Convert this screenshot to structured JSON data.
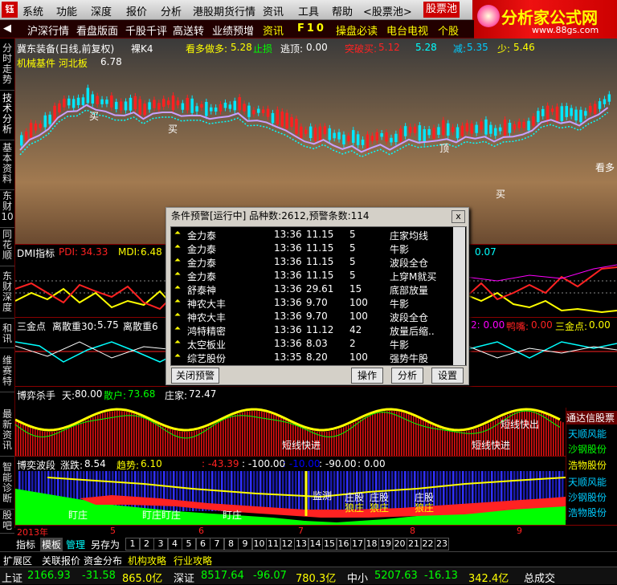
{
  "menu": {
    "logo": "钰",
    "items": [
      "系统",
      "功能",
      "深度",
      "报价",
      "分析",
      "港股期货行情",
      "资讯",
      "工具",
      "帮助",
      "<股票池>",
      "股票池"
    ],
    "brand_title": "分析家公式网",
    "brand_url": "www.88gs.com"
  },
  "toolbar": {
    "items": [
      "沪深行情",
      "看盘版面",
      "千股千评",
      "高送转",
      "业绩预增",
      "资讯",
      "F10",
      "操盘必读",
      "电台电视",
      "个股"
    ]
  },
  "left_tabs": [
    "分时走势",
    "技术分析",
    "基本资料",
    "东财10",
    "同花顺",
    "东财深度",
    "和讯",
    "维赛特",
    "最新资讯",
    "智能诊断",
    "股吧"
  ],
  "main_chart": {
    "title": "冀东装备(日线,前复权)",
    "mode": "裸K4",
    "indicator_name": "看多做多:",
    "indicator_value": "5.28",
    "stoploss_label": "止损",
    "escape_label": "逃顶:",
    "escape_value": "0.00",
    "breakout_label": "突破买:",
    "breakout_value": "5.12",
    "extra_value": "5.28",
    "reduce_label": "减:",
    "reduce_value": "5.35",
    "less_label": "少:",
    "less_value": "5.46",
    "sector_label": "机械基件 河北板",
    "high_price": "6.78",
    "buy_label": "买",
    "watch_label": "看多",
    "top_label": "顶"
  },
  "dmi_panel": {
    "name": "DMI指标",
    "pdi_label": "PDI:",
    "pdi_value": "34.33",
    "mdi_label": "MDI:",
    "mdi_value": "6.48",
    "right_value": "0.07"
  },
  "golden_panel": {
    "name": "三金点",
    "away_label": "离散重30:",
    "away_value": "5.75",
    "away2_label": "离散重6",
    "duck_label": "鸭嘴:",
    "duck_value": "0.00",
    "gold_label": "三金点:",
    "gold_value": "0.00",
    "left_value": "2: 0.00"
  },
  "game_panel": {
    "name": "博弈杀手",
    "sky_label": "天:",
    "sky_value": "80.00",
    "retail_label": "散户:",
    "retail_value": "73.68",
    "main_label": "庄家:",
    "main_value": "72.47",
    "short_label": "短线快进",
    "short_label2": "短线快进",
    "short_out_label": "短线快出"
  },
  "wave_panel": {
    "name": "博奕波段",
    "change_label": "涨跌:",
    "change_value": "8.54",
    "trend_label": "趋势:",
    "trend_value": "6.10",
    "v1": ": -43.39",
    "v2": ": -100.00",
    "v3": ": -10.00",
    "v4": ": -90.00",
    "v5": ": 0.00",
    "monitor_label": "监测",
    "dealer_labels": [
      "庄股",
      "庄股",
      "庄股"
    ],
    "dealer_sub": [
      "狼庄",
      "狼庄",
      "狼庄"
    ],
    "buy_labels": [
      "盯庄",
      "盯庄盯庄",
      "盯庄"
    ]
  },
  "dialog": {
    "title": "条件预警[运行中] 品种数:2612,预警条数:114",
    "close": "x",
    "rows": [
      {
        "name": "金力泰",
        "time": "13:36",
        "price": "11.15",
        "vol": "5",
        "signal": "庄家均线"
      },
      {
        "name": "金力泰",
        "time": "13:36",
        "price": "11.15",
        "vol": "5",
        "signal": "牛影"
      },
      {
        "name": "金力泰",
        "time": "13:36",
        "price": "11.15",
        "vol": "5",
        "signal": "波段全仓"
      },
      {
        "name": "金力泰",
        "time": "13:36",
        "price": "11.15",
        "vol": "5",
        "signal": "上穿M就买"
      },
      {
        "name": "舒泰神",
        "time": "13:36",
        "price": "29.61",
        "vol": "15",
        "signal": "底部放量"
      },
      {
        "name": "神农大丰",
        "time": "13:36",
        "price": "9.70",
        "vol": "100",
        "signal": "牛影"
      },
      {
        "name": "神农大丰",
        "time": "13:36",
        "price": "9.70",
        "vol": "100",
        "signal": "波段全仓"
      },
      {
        "name": "鸿特精密",
        "time": "13:36",
        "price": "11.12",
        "vol": "42",
        "signal": "放量后缩.."
      },
      {
        "name": "太空板业",
        "time": "13:36",
        "price": "8.03",
        "vol": "2",
        "signal": "牛影"
      },
      {
        "name": "综艺股份",
        "time": "13:35",
        "price": "8.20",
        "vol": "100",
        "signal": "强势牛股"
      }
    ],
    "btn_close": "关闭预警",
    "btn_action": "操作",
    "btn_analyze": "分析",
    "btn_settings": "设置"
  },
  "right_list": [
    "通达信股票",
    "天顺风能",
    "沙钢股份",
    "浩物股份",
    "天顺风能",
    "沙钢股份",
    "浩物股份"
  ],
  "date_axis": {
    "year": "2013年",
    "months": [
      "5",
      "6",
      "7",
      "8",
      "9"
    ]
  },
  "bottom_tabs": {
    "tabs": [
      "指标",
      "模板",
      "管理",
      "另存为"
    ],
    "numbers": [
      "1",
      "2",
      "3",
      "4",
      "5",
      "6",
      "7",
      "8",
      "9",
      "10",
      "11",
      "12",
      "13",
      "14",
      "15",
      "16",
      "17",
      "18",
      "19",
      "20",
      "21",
      "22",
      "23"
    ]
  },
  "func_bar": [
    "扩展区",
    "关联报价",
    "资金分布",
    "机构攻略",
    "行业攻略"
  ],
  "status": {
    "sh_label": "上证",
    "sh_value": "2166.93",
    "sh_change": "-31.58",
    "sh_amount": "865.0亿",
    "sz_label": "深证",
    "sz_value": "8517.64",
    "sz_change": "-96.07",
    "sz_amount": "780.3亿",
    "zx_label": "中小",
    "zx_value": "5207.63",
    "zx_change": "-16.13",
    "zx_amount": "342.4亿",
    "total_label": "总成交"
  },
  "colors": {
    "red": "#ff2020",
    "yellow": "#ffff00",
    "green": "#00ff00",
    "cyan": "#00ffff",
    "magenta": "#ff00ff"
  }
}
